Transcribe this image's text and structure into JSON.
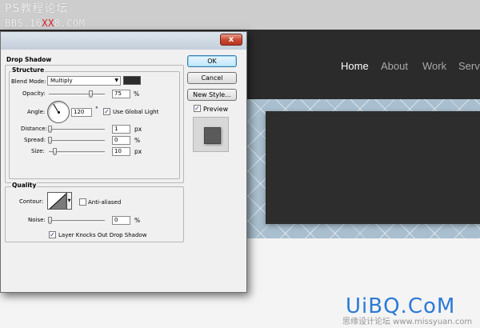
{
  "watermark": {
    "title": "PS教程论坛",
    "url_prefix": "BBS.16",
    "url_red": "XX",
    "url_suffix": "8.COM",
    "bottom_logo": "UiBQ.CoM",
    "bottom_small": "思缘设计论坛 www.missyuan.com"
  },
  "website": {
    "nav": [
      "Home",
      "About",
      "Work",
      "Servi"
    ],
    "active_nav": "Home"
  },
  "dialog": {
    "close_symbol": "x",
    "section_title": "Drop Shadow",
    "structure": {
      "title": "Structure",
      "blend_mode_label": "Blend Mode:",
      "blend_mode_value": "Multiply",
      "shadow_color": "#2c2c2c",
      "opacity_label": "Opacity:",
      "opacity_value": "75",
      "opacity_unit": "%",
      "angle_label": "Angle:",
      "angle_value": "120",
      "angle_unit": "°",
      "global_light_label": "Use Global Light",
      "global_light_checked": true,
      "distance_label": "Distance:",
      "distance_value": "1",
      "distance_unit": "px",
      "spread_label": "Spread:",
      "spread_value": "0",
      "spread_unit": "%",
      "size_label": "Size:",
      "size_value": "10",
      "size_unit": "px"
    },
    "quality": {
      "title": "Quality",
      "contour_label": "Contour:",
      "anti_aliased_label": "Anti-aliased",
      "anti_aliased_checked": false,
      "noise_label": "Noise:",
      "noise_value": "0",
      "noise_unit": "%"
    },
    "knockout_label": "Layer Knocks Out Drop Shadow",
    "knockout_checked": true,
    "buttons": {
      "ok": "OK",
      "cancel": "Cancel",
      "new_style": "New Style..."
    },
    "preview_label": "Preview",
    "preview_checked": true,
    "check_mark": "✓",
    "dropdown_arrow": "▼"
  }
}
